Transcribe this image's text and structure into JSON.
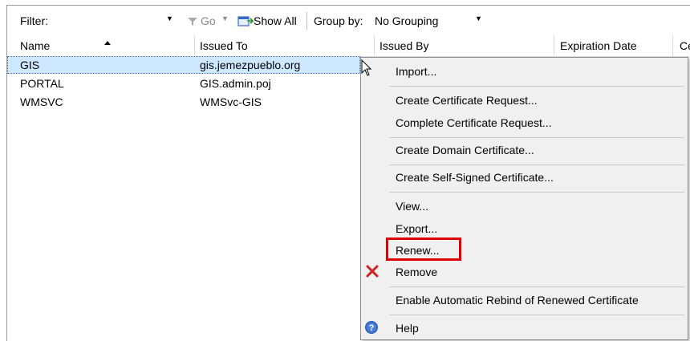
{
  "toolbar": {
    "filter_label": "Filter:",
    "go_label": "Go",
    "show_all_label": "Show All",
    "group_by_label": "Group by:",
    "grouping_value": "No Grouping"
  },
  "columns": {
    "name": "Name",
    "issued_to": "Issued To",
    "issued_by": "Issued By",
    "expiration_date": "Expiration Date",
    "extra": "Ce"
  },
  "rows": [
    {
      "name": "GIS",
      "issued_to": "gis.jemezpueblo.org",
      "selected": true
    },
    {
      "name": "PORTAL",
      "issued_to": "GIS.admin.poj",
      "selected": false
    },
    {
      "name": "WMSVC",
      "issued_to": "WMSvc-GIS",
      "selected": false
    }
  ],
  "menu": {
    "import": "Import...",
    "create_request": "Create Certificate Request...",
    "complete_request": "Complete Certificate Request...",
    "create_domain": "Create Domain Certificate...",
    "create_self_signed": "Create Self-Signed Certificate...",
    "view": "View...",
    "export": "Export...",
    "renew": "Renew...",
    "remove": "Remove",
    "enable_rebind": "Enable Automatic Rebind of Renewed Certificate",
    "help": "Help"
  },
  "colors": {
    "selection": "#cde8ff",
    "highlight_box": "#e00000",
    "remove_icon": "#d02020",
    "help_icon": "#2b5bb8"
  }
}
